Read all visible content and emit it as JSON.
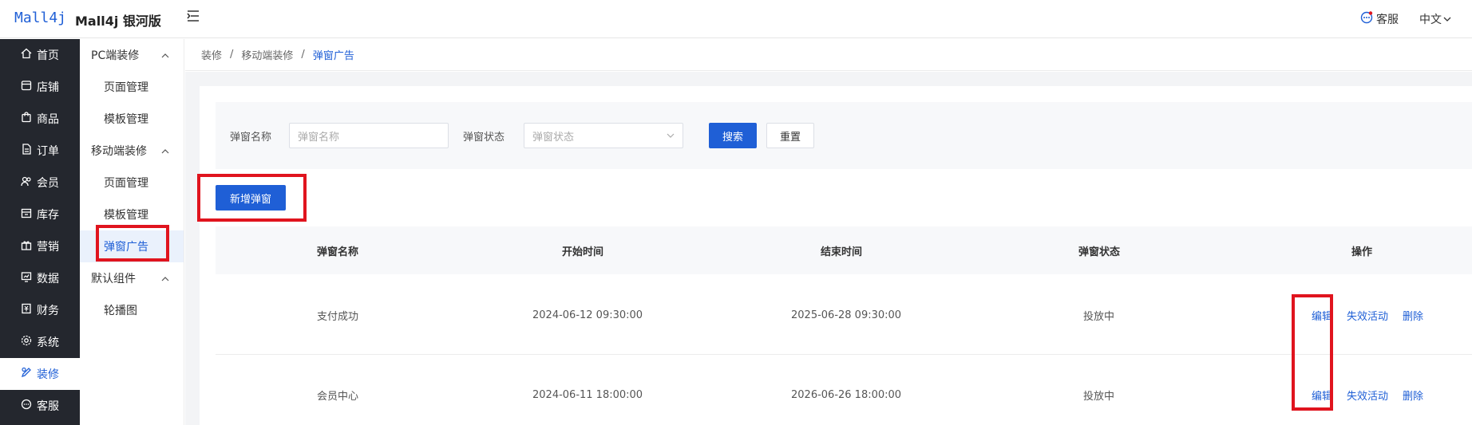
{
  "header": {
    "logo_text": "Mall4j",
    "brand": "Mall4j 银河版",
    "service_label": "客服",
    "language": "中文"
  },
  "nav": {
    "items": [
      {
        "label": "首页",
        "icon": "home-icon"
      },
      {
        "label": "店铺",
        "icon": "store-icon"
      },
      {
        "label": "商品",
        "icon": "bag-icon"
      },
      {
        "label": "订单",
        "icon": "order-icon"
      },
      {
        "label": "会员",
        "icon": "users-icon"
      },
      {
        "label": "库存",
        "icon": "inventory-icon"
      },
      {
        "label": "营销",
        "icon": "gift-icon"
      },
      {
        "label": "数据",
        "icon": "chart-icon"
      },
      {
        "label": "财务",
        "icon": "finance-icon"
      },
      {
        "label": "系统",
        "icon": "gear-icon"
      },
      {
        "label": "装修",
        "icon": "decorate-icon"
      },
      {
        "label": "客服",
        "icon": "chat-icon"
      }
    ],
    "active_label": "装修"
  },
  "submenu": {
    "pc_group": "PC端装修",
    "pc_items": [
      "页面管理",
      "模板管理"
    ],
    "mobile_group": "移动端装修",
    "mobile_items": [
      "页面管理",
      "模板管理",
      "弹窗广告"
    ],
    "default_group": "默认组件",
    "default_items": [
      "轮播图"
    ],
    "active_item": "弹窗广告"
  },
  "breadcrumb": {
    "items": [
      "装修",
      "移动端装修",
      "弹窗广告"
    ],
    "separator": "/"
  },
  "search": {
    "name_label": "弹窗名称",
    "name_placeholder": "弹窗名称",
    "status_label": "弹窗状态",
    "status_placeholder": "弹窗状态",
    "search_button": "搜索",
    "reset_button": "重置"
  },
  "actions": {
    "add_button": "新增弹窗"
  },
  "table": {
    "columns": [
      "弹窗名称",
      "开始时间",
      "结束时间",
      "弹窗状态",
      "操作"
    ],
    "rows": [
      {
        "name": "支付成功",
        "start": "2024-06-12 09:30:00",
        "end": "2025-06-28 09:30:00",
        "status": "投放中",
        "ops": [
          "编辑",
          "失效活动",
          "删除"
        ]
      },
      {
        "name": "会员中心",
        "start": "2024-06-11 18:00:00",
        "end": "2026-06-26 18:00:00",
        "status": "投放中",
        "ops": [
          "编辑",
          "失效活动",
          "删除"
        ]
      }
    ]
  },
  "colors": {
    "primary": "#1f5fd6",
    "nav_bg": "#24272e",
    "highlight": "#e0141e"
  }
}
